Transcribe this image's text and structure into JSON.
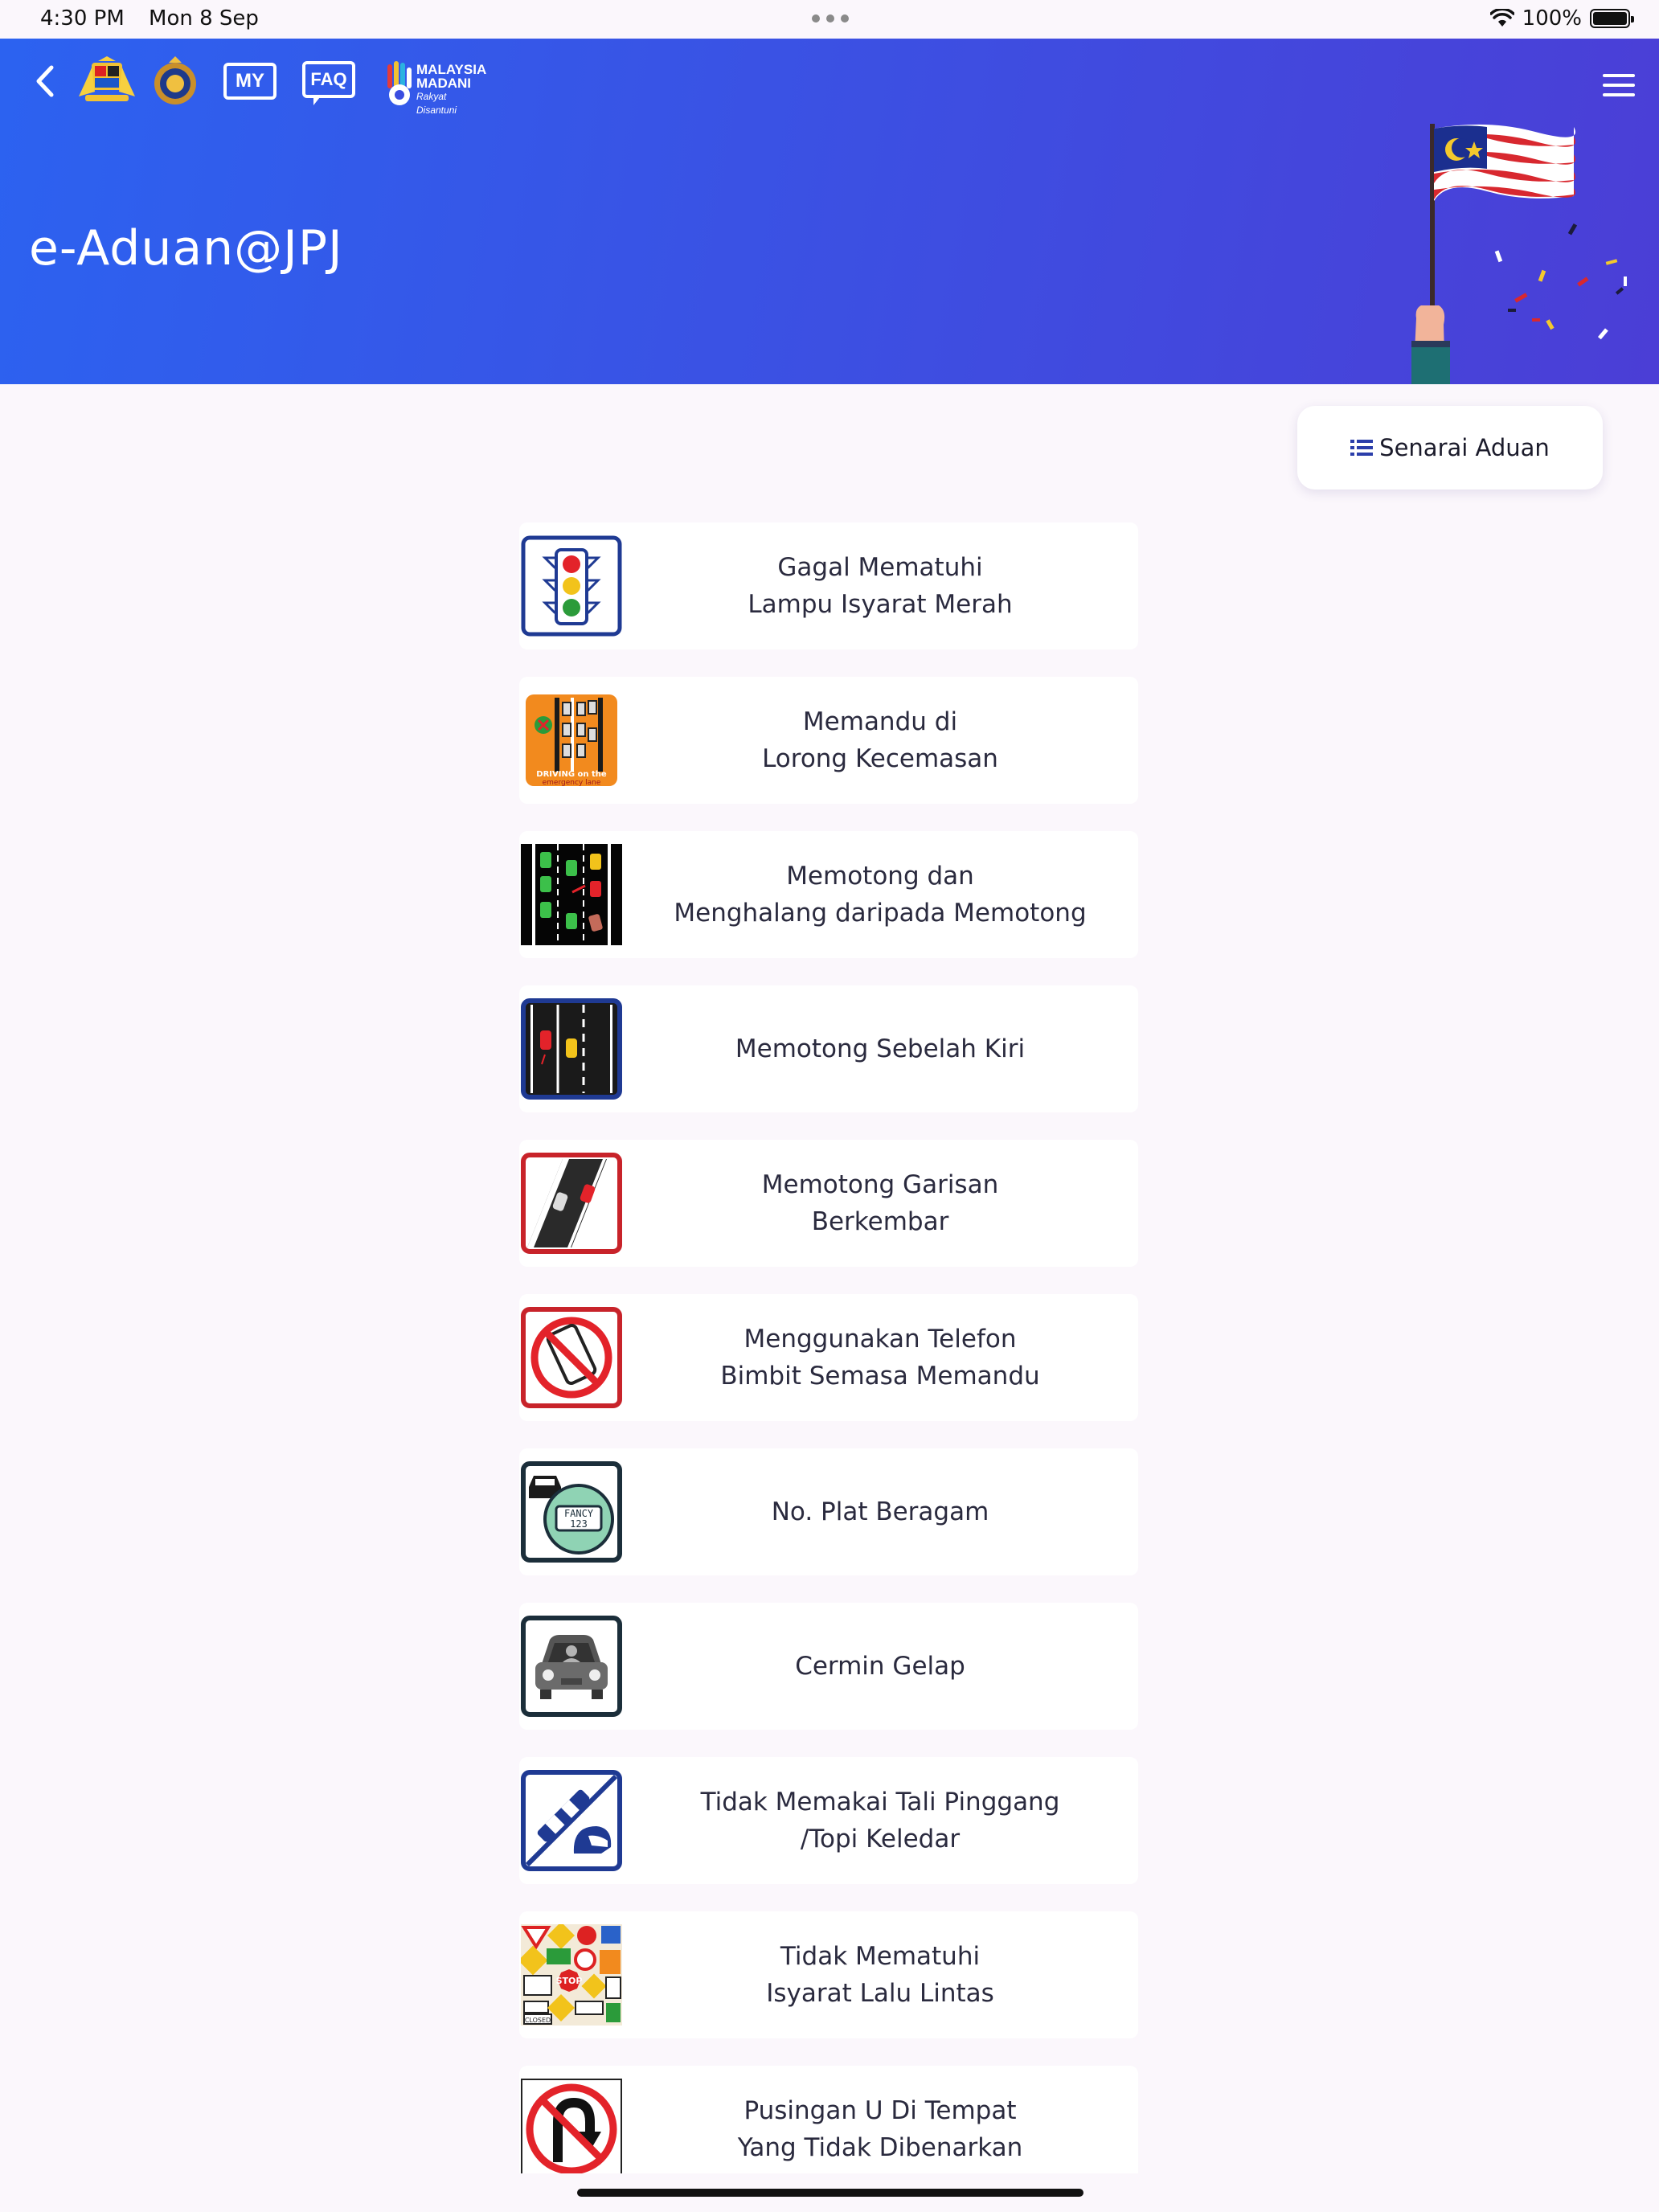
{
  "status_bar": {
    "time": "4:30 PM",
    "date": "Mon 8 Sep",
    "battery": "100%"
  },
  "header": {
    "title": "e-Aduan@JPJ",
    "logo_my": "MY",
    "logo_faq": "FAQ",
    "madani_line1": "MALAYSIA",
    "madani_line2": "MADANI",
    "madani_line3": "Rakyat Disantuni"
  },
  "actions": {
    "senarai_label": "Senarai Aduan"
  },
  "colors": {
    "header_start": "#2c62f0",
    "header_end": "#4b3ed6",
    "page_bg": "#fbf7fc",
    "accent_blue": "#2b3eaa"
  },
  "complaints": [
    {
      "line1": "Gagal Mematuhi",
      "line2": "Lampu Isyarat Merah",
      "icon": "traffic-light-icon"
    },
    {
      "line1": "Memandu di",
      "line2": "Lorong Kecemasan",
      "icon": "emergency-lane-icon",
      "icon_caption_1": "DRIVING on the",
      "icon_caption_2": "emergency lane"
    },
    {
      "line1": "Memotong dan",
      "line2": "Menghalang daripada Memotong",
      "icon": "overtaking-blocking-icon"
    },
    {
      "line1": "Memotong Sebelah Kiri",
      "line2": "",
      "icon": "left-overtake-icon"
    },
    {
      "line1": "Memotong Garisan",
      "line2": "Berkembar",
      "icon": "double-line-icon"
    },
    {
      "line1": "Menggunakan Telefon",
      "line2": "Bimbit Semasa Memandu",
      "icon": "no-phone-icon"
    },
    {
      "line1": "No. Plat Beragam",
      "line2": "",
      "icon": "fancy-plate-icon",
      "icon_caption_1": "FANCY",
      "icon_caption_2": "123"
    },
    {
      "line1": "Cermin Gelap",
      "line2": "",
      "icon": "tinted-window-icon"
    },
    {
      "line1": "Tidak Memakai Tali Pinggang",
      "line2": "/Topi Keledar",
      "icon": "seatbelt-helmet-icon"
    },
    {
      "line1": "Tidak Mematuhi",
      "line2": "Isyarat Lalu Lintas",
      "icon": "traffic-signs-icon",
      "icon_caption_1": "STOP",
      "icon_caption_2": "CLOSED"
    },
    {
      "line1": "Pusingan U Di Tempat",
      "line2": "Yang Tidak Dibenarkan",
      "icon": "no-u-turn-icon"
    }
  ]
}
